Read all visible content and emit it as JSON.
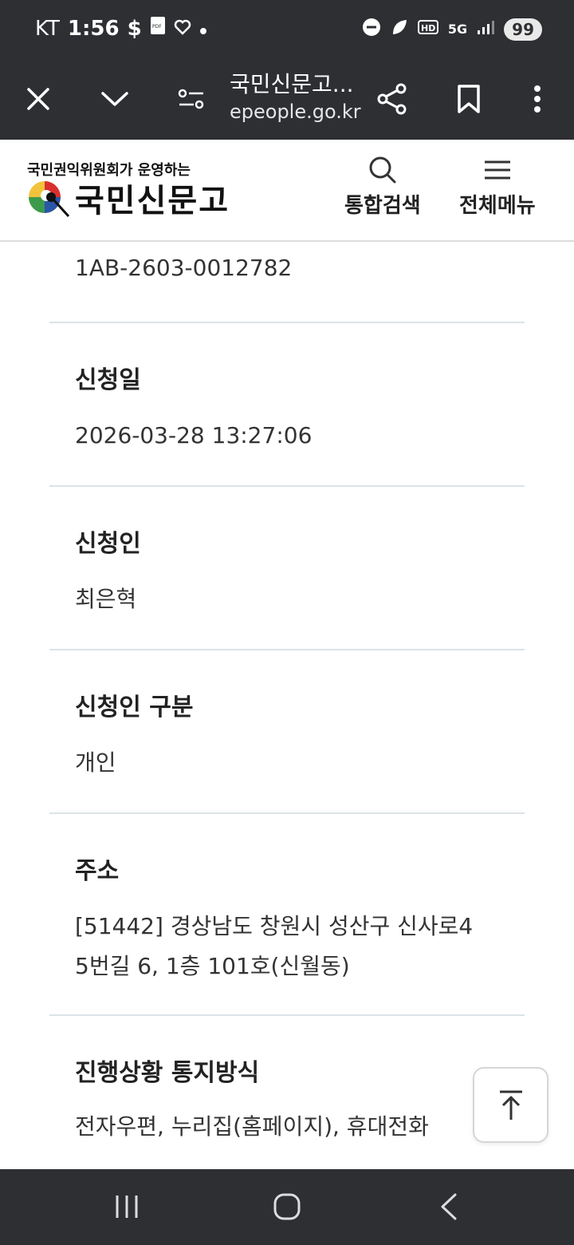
{
  "status_bar": {
    "carrier": "KT",
    "time": "1:56",
    "network": "5G",
    "battery": "99"
  },
  "browser": {
    "title": "국민신문고...",
    "url": "epeople.go.kr"
  },
  "site_header": {
    "tagline": "국민권익위원회가 운영하는",
    "logo_text": "국민신문고",
    "search_label": "통합검색",
    "menu_label": "전체메뉴"
  },
  "details": {
    "application_number": "1AB-2603-0012782",
    "fields": [
      {
        "label": "신청일",
        "value": "2026-03-28 13:27:06"
      },
      {
        "label": "신청인",
        "value": "최은혁"
      },
      {
        "label": "신청인 구분",
        "value": "개인"
      },
      {
        "label": "주소",
        "value_line1": "[51442] 경상남도 창원시 성산구 신사로4",
        "value_line2": "5번길 6, 1층 101호(신월동)"
      },
      {
        "label": "진행상황 통지방식",
        "value": "전자우편, 누리집(홈페이지), 휴대전화"
      }
    ]
  },
  "colors": {
    "dark_bar": "#2d2f33",
    "divider": "#dbe3e6"
  }
}
